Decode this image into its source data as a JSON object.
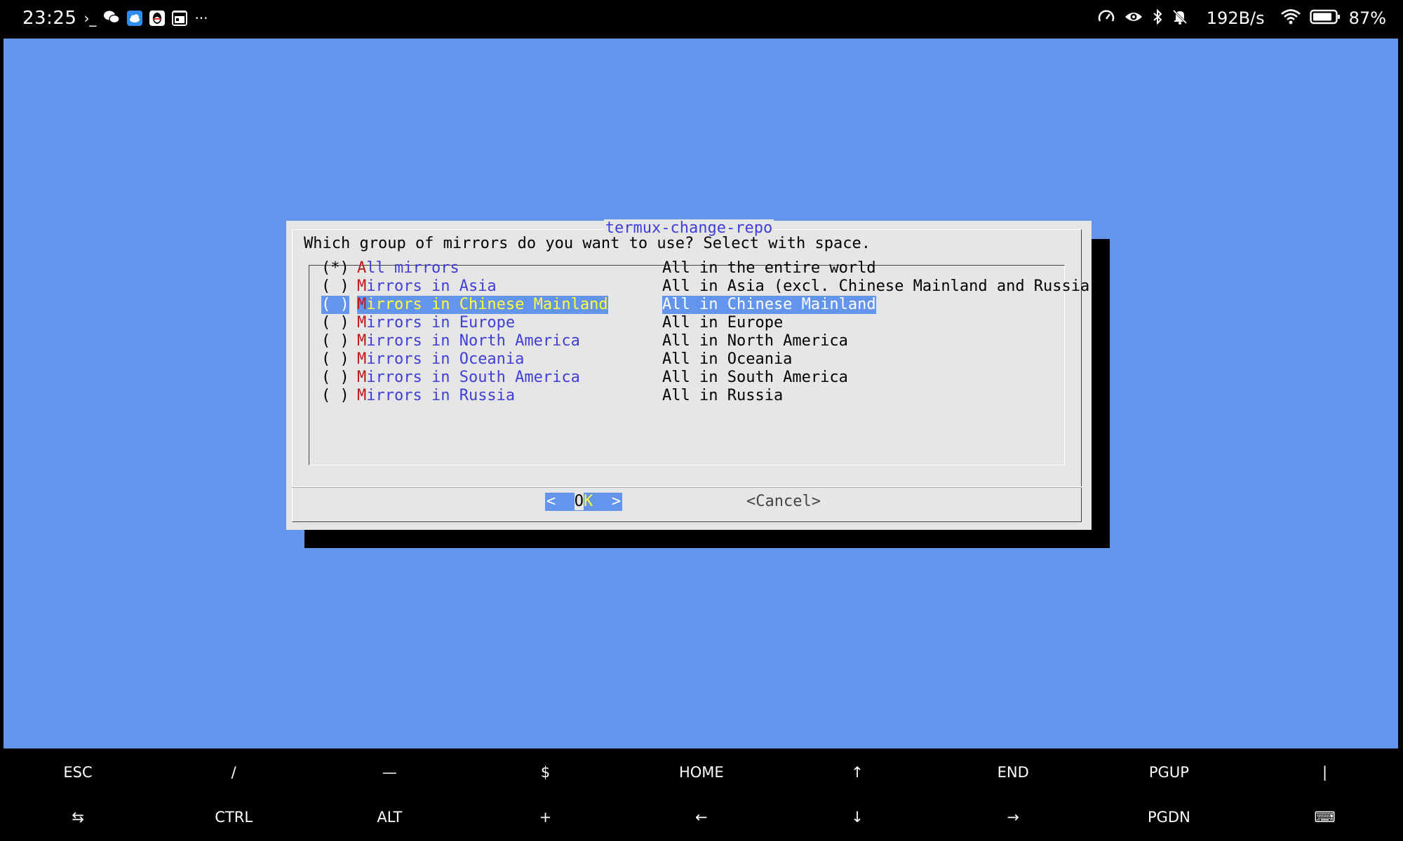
{
  "status_bar": {
    "time": "23:25",
    "left_icons": [
      "terminal-prompt-icon",
      "wechat-icon",
      "cloud-app-icon",
      "qq-icon",
      "calendar-app-icon",
      "more-icon"
    ],
    "net_speed": "192B/s",
    "battery_percent": "87%",
    "battery_level": 0.87,
    "right_icons": [
      "speed-gauge-icon",
      "eye-icon",
      "bluetooth-icon",
      "mute-bell-icon",
      "wifi-icon",
      "battery-icon"
    ],
    "terminal_glyph": "›_",
    "more_glyph": "···"
  },
  "dialog": {
    "title": "termux-change-repo",
    "prompt": "Which group of mirrors do you want to use? Select with space.",
    "items": [
      {
        "radio": "(*)",
        "hot": "A",
        "rest": "ll mirrors",
        "desc": "All in the entire world",
        "selected": false
      },
      {
        "radio": "( )",
        "hot": "M",
        "rest": "irrors in Asia",
        "desc": "All in Asia (excl. Chinese Mainland and Russia)",
        "selected": false
      },
      {
        "radio": "( )",
        "hot": "M",
        "rest": "irrors in Chinese Mainland",
        "desc": "All in Chinese Mainland",
        "selected": true
      },
      {
        "radio": "( )",
        "hot": "M",
        "rest": "irrors in Europe",
        "desc": "All in Europe",
        "selected": false
      },
      {
        "radio": "( )",
        "hot": "M",
        "rest": "irrors in North America",
        "desc": "All in North America",
        "selected": false
      },
      {
        "radio": "( )",
        "hot": "M",
        "rest": "irrors in Oceania",
        "desc": "All in Oceania",
        "selected": false
      },
      {
        "radio": "( )",
        "hot": "M",
        "rest": "irrors in South America",
        "desc": "All in South America",
        "selected": false
      },
      {
        "radio": "( )",
        "hot": "M",
        "rest": "irrors in Russia",
        "desc": "All in Russia",
        "selected": false
      }
    ],
    "ok": {
      "left": "<  ",
      "o": "O",
      "k": "K",
      "right": "  >"
    },
    "cancel": "<Cancel>"
  },
  "extra_keys": {
    "row1": [
      "ESC",
      "/",
      "—",
      "$",
      "HOME",
      "↑",
      "END",
      "PGUP",
      "|"
    ],
    "row2": [
      "⇆",
      "CTRL",
      "ALT",
      "+",
      "←",
      "↓",
      "→",
      "PGDN",
      "⌨"
    ]
  },
  "colors": {
    "terminal_bg": "#6495ed",
    "dialog_bg": "#e6e6e6",
    "item_text": "#3f3fd8",
    "hotkey": "#c01818",
    "highlight": "#ffff40"
  }
}
